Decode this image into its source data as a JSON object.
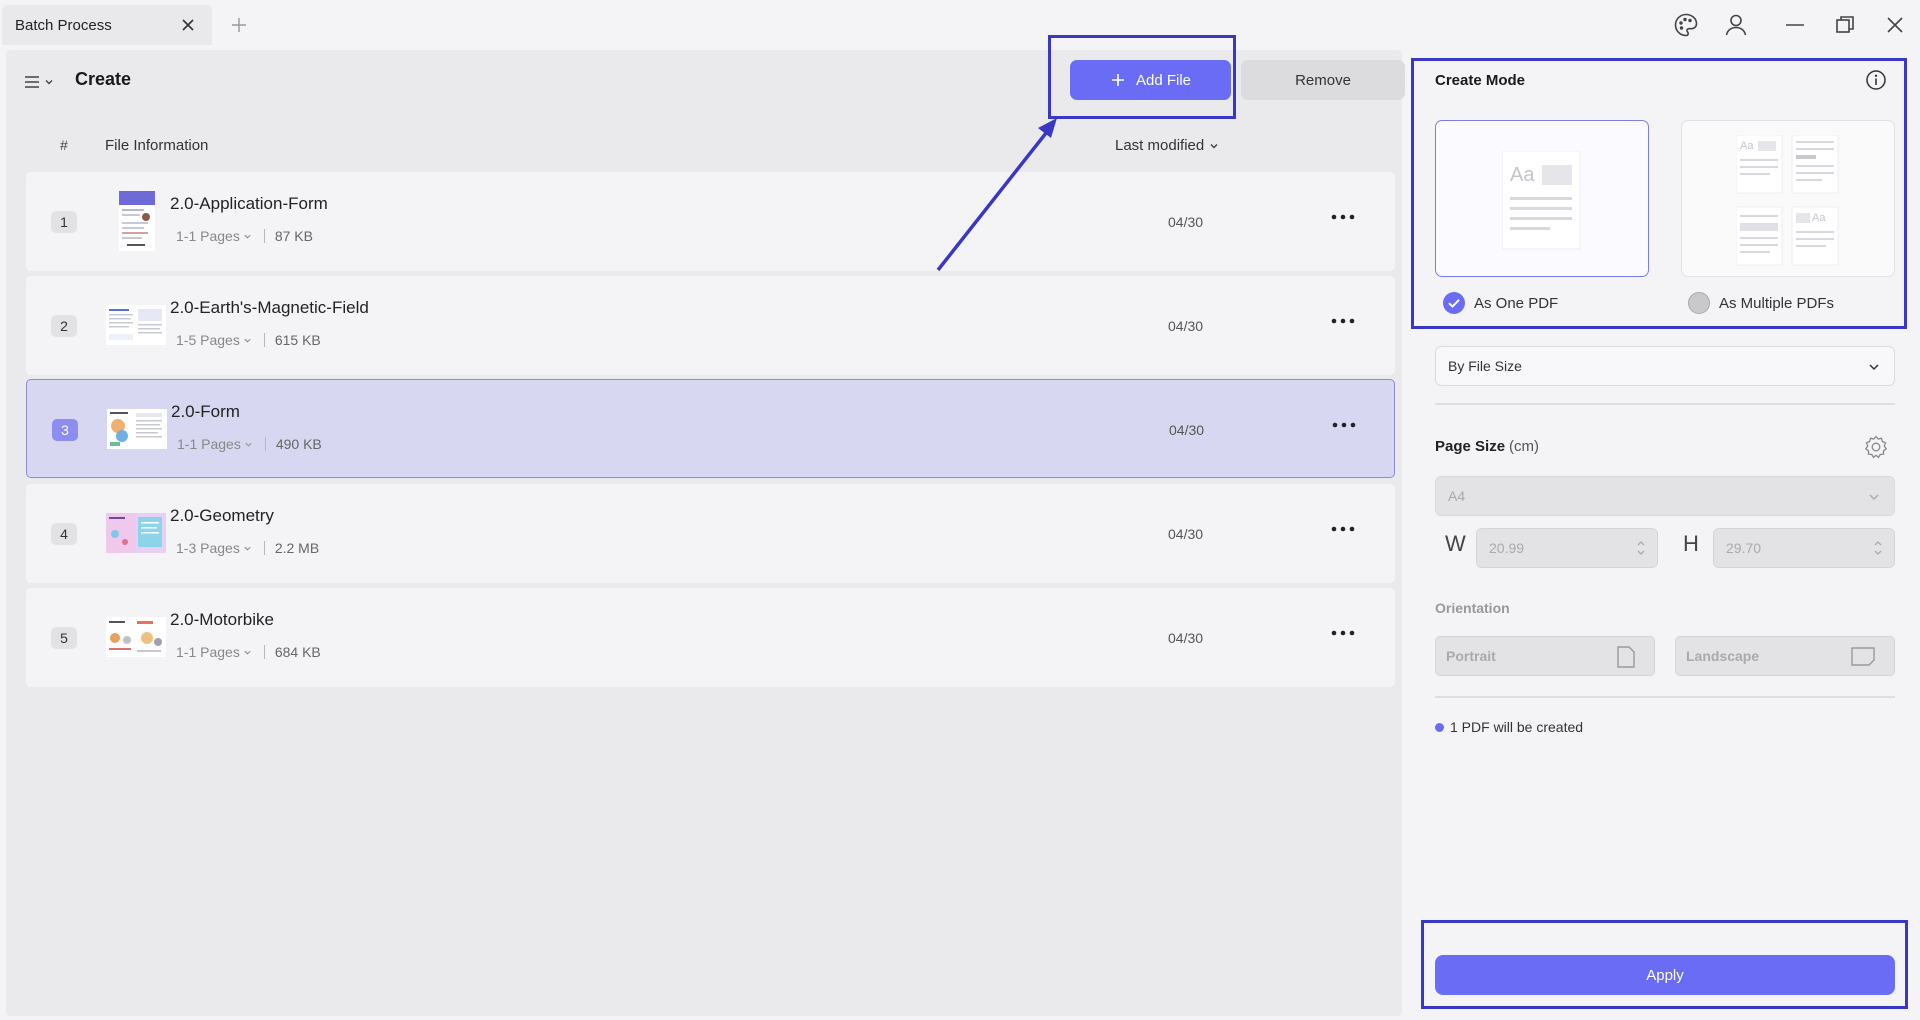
{
  "window": {
    "tab_title": "Batch Process"
  },
  "header": {
    "title": "Create",
    "add_file_label": "Add File",
    "remove_label": "Remove"
  },
  "table": {
    "col_number": "#",
    "col_info": "File Information",
    "col_modified": "Last modified",
    "rows": [
      {
        "num": "1",
        "name": "2.0-Application-Form",
        "pages": "1-1 Pages",
        "size": "87 KB",
        "date": "04/30",
        "selected": false
      },
      {
        "num": "2",
        "name": "2.0-Earth's-Magnetic-Field",
        "pages": "1-5 Pages",
        "size": "615 KB",
        "date": "04/30",
        "selected": false
      },
      {
        "num": "3",
        "name": "2.0-Form",
        "pages": "1-1 Pages",
        "size": "490 KB",
        "date": "04/30",
        "selected": true
      },
      {
        "num": "4",
        "name": "2.0-Geometry",
        "pages": "1-3 Pages",
        "size": "2.2 MB",
        "date": "04/30",
        "selected": false
      },
      {
        "num": "5",
        "name": "2.0-Motorbike",
        "pages": "1-1 Pages",
        "size": "684 KB",
        "date": "04/30",
        "selected": false
      }
    ]
  },
  "settings": {
    "create_mode_title": "Create Mode",
    "mode_one_label": "As One PDF",
    "mode_multiple_label": "As Multiple PDFs",
    "mode_selected": "As One PDF",
    "sort_select": "By File Size",
    "page_size_label": "Page Size",
    "page_size_unit": "(cm)",
    "page_size_value": "A4",
    "width_label": "W",
    "width_value": "20.99",
    "height_label": "H",
    "height_value": "29.70",
    "orientation_label": "Orientation",
    "portrait_label": "Portrait",
    "landscape_label": "Landscape",
    "status_text": "1 PDF will be created",
    "apply_label": "Apply"
  },
  "colors": {
    "accent": "#6b6cf5",
    "selected_row": "#d7d7f1",
    "annotation": "#3b37c6"
  },
  "icons": [
    "close-icon",
    "plus-icon",
    "palette-icon",
    "user-icon",
    "minimize-icon",
    "restore-icon",
    "window-close-icon",
    "menu-icon",
    "chevron-down-icon",
    "more-icon",
    "info-icon",
    "check-icon",
    "gear-icon",
    "stepper-icon",
    "portrait-icon",
    "landscape-icon"
  ]
}
